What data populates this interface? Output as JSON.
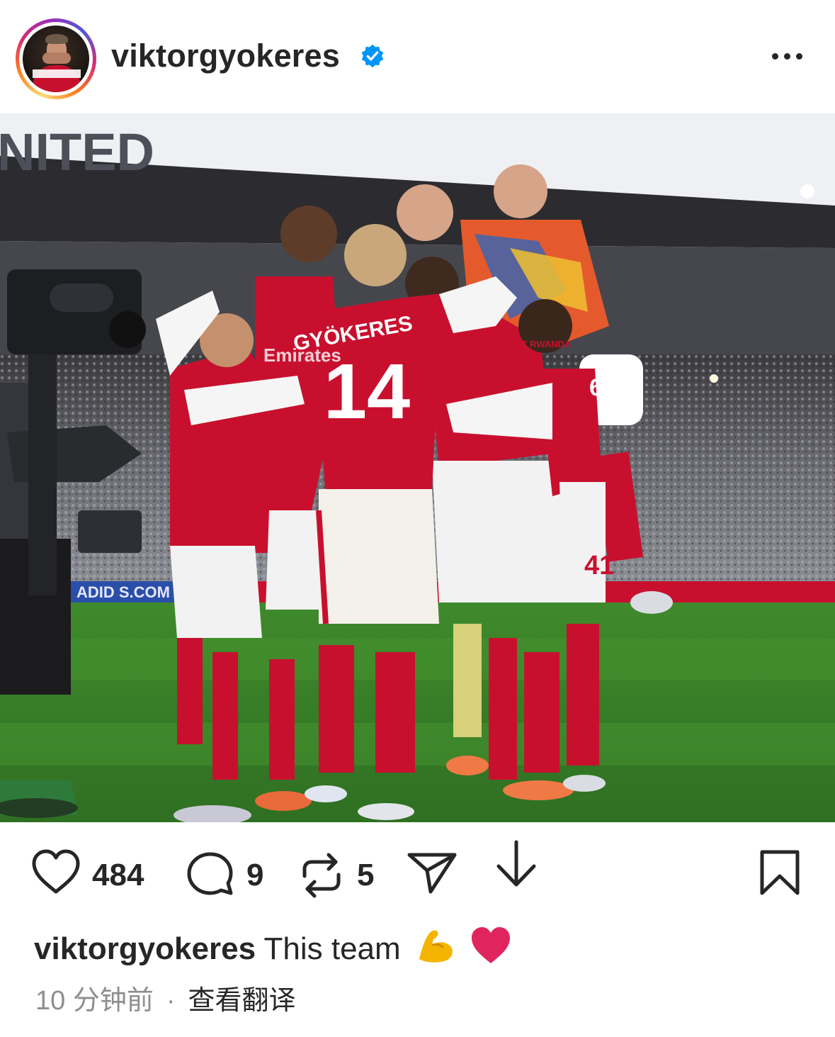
{
  "post": {
    "username": "viktorgyokeres",
    "verified": true
  },
  "header": {
    "avatar": "profile-avatar",
    "more_icon": "more-horizontal-icon"
  },
  "photo": {
    "visible_text": {
      "stadium_sign": "NITED",
      "jersey_name": "GYÖKERES",
      "jersey_number": "14",
      "shorts_number": "41",
      "sleeve_number": "6",
      "board_text": "ADID S.COM",
      "sponsor": "Emirates",
      "sleeve_sponsor": "VISIT RWANDA"
    }
  },
  "actions": {
    "likes": "484",
    "comments": "9",
    "reposts": "5",
    "icons": [
      "heart-icon",
      "comment-icon",
      "repost-icon",
      "share-icon",
      "download-icon",
      "bookmark-icon"
    ]
  },
  "caption": {
    "username": "viktorgyokeres",
    "text": "This team",
    "emojis": [
      "flexed-biceps",
      "red-heart"
    ]
  },
  "meta": {
    "time_ago": "10 分钟前",
    "separator": "·",
    "translate": "查看翻译"
  },
  "colors": {
    "text": "#262626",
    "secondary": "#8e8e8e",
    "verified": "#0095f6",
    "arsenal_red": "#c8102e",
    "heart_emoji": "#e0245e"
  }
}
